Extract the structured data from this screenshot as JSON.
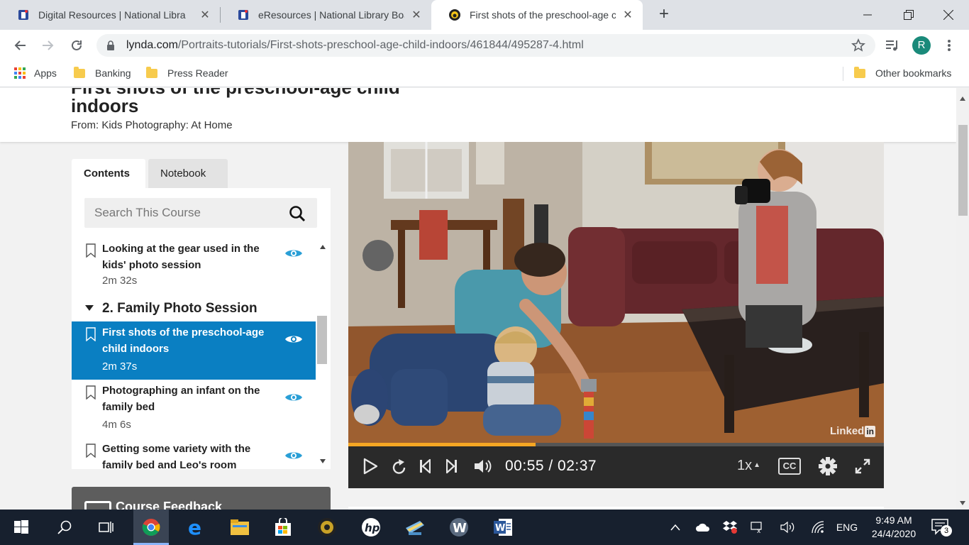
{
  "browser": {
    "tabs": [
      {
        "title": "Digital Resources | National Libra",
        "active": false
      },
      {
        "title": "eResources | National Library Boa",
        "active": false
      },
      {
        "title": "First shots of the preschool-age c",
        "active": true
      }
    ],
    "url_host": "lynda.com",
    "url_path": "/Portraits-tutorials/First-shots-preschool-age-child-indoors/461844/495287-4.html",
    "profile_initial": "R",
    "bookmarks": [
      "Apps",
      "Banking",
      "Press Reader"
    ],
    "other_bookmarks": "Other bookmarks"
  },
  "page": {
    "title_clipped": "First shots of the preschool-age child",
    "title_line2": "indoors",
    "from": "From: Kids Photography: At Home"
  },
  "sidebar": {
    "tabs": [
      "Contents",
      "Notebook"
    ],
    "search_placeholder": "Search This Course",
    "items": [
      {
        "title": "Looking at the gear used in the kids' photo session",
        "duration": "2m 32s"
      },
      {
        "chapter": "2. Family Photo Session"
      },
      {
        "title": "First shots of the preschool-age child indoors",
        "duration": "2m 37s",
        "current": true
      },
      {
        "title": "Photographing an infant on the family bed",
        "duration": "4m 6s"
      },
      {
        "title": "Getting some variety with the family bed and Leo's room",
        "duration": ""
      }
    ],
    "feedback_label": "Course Feedback"
  },
  "player": {
    "time": "00:55 / 02:37",
    "progress_fraction": 0.35,
    "speed": "1x",
    "cc_label": "CC",
    "watermark": "Linked",
    "watermark_in": "in"
  },
  "taskbar": {
    "lang": "ENG",
    "time": "9:49 AM",
    "date": "24/4/2020",
    "notification_count": "3"
  },
  "colors": {
    "accent_blue": "#0a7fc2",
    "progress_orange": "#f5a623",
    "eye_blue": "#2a9fd6"
  }
}
